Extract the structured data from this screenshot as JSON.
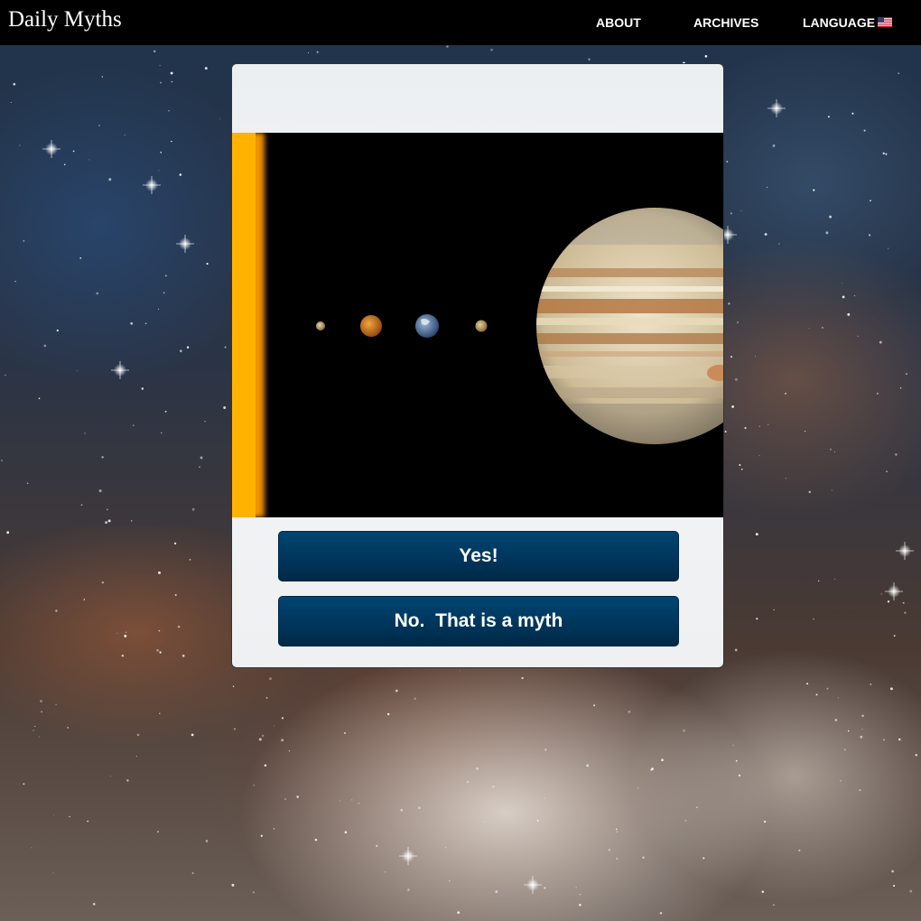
{
  "site": {
    "brand": "Daily Myths"
  },
  "nav": {
    "about": "ABOUT",
    "archives": "ARCHIVES",
    "language": "LANGUAGE"
  },
  "icons": {
    "language_flag": "us-flag-icon"
  },
  "figure": {
    "subject": "sun-and-planets-image"
  },
  "answers": {
    "yes": "Yes!",
    "no": "No.  That is a myth"
  },
  "colors": {
    "topbar": "#000000",
    "button": "#00365c",
    "card": "#f1f2f3"
  }
}
